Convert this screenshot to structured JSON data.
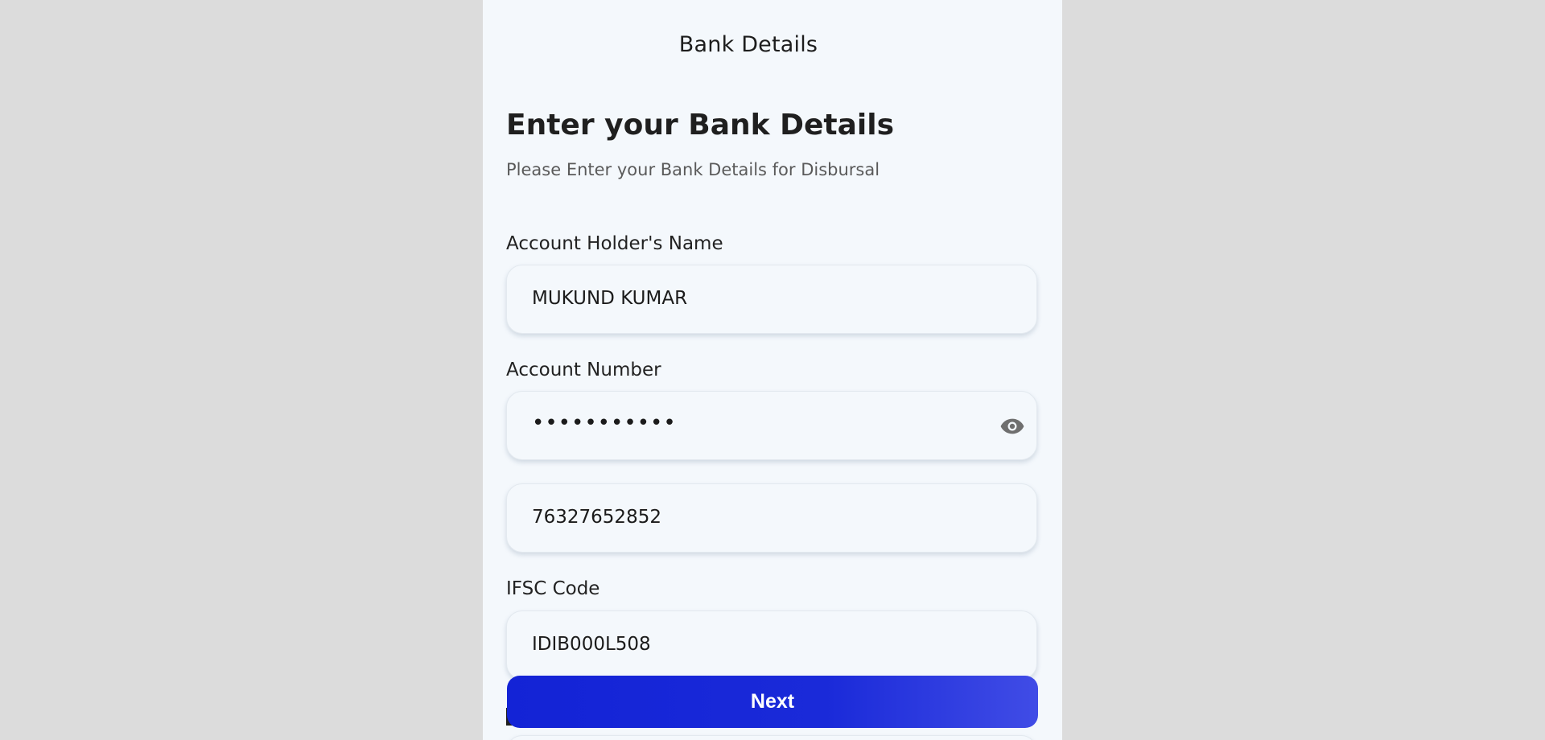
{
  "header": {
    "title": "Bank Details"
  },
  "form": {
    "heading": "Enter your Bank Details",
    "subheading": "Please Enter your Bank Details for Disbursal",
    "account_holder_label": "Account Holder's Name",
    "account_holder_value": "MUKUND KUMAR",
    "account_number_label": "Account Number",
    "account_number_masked": "•••••••••••",
    "confirm_account_number_value": "76327652852",
    "ifsc_label": "IFSC Code",
    "ifsc_value": "IDIB000L508"
  },
  "actions": {
    "next_label": "Next"
  },
  "icons": {
    "password_toggle": "eye-icon"
  },
  "colors": {
    "primary": "#1323d6",
    "background": "#f4f8fc",
    "page_backdrop": "#dcdcdc"
  }
}
